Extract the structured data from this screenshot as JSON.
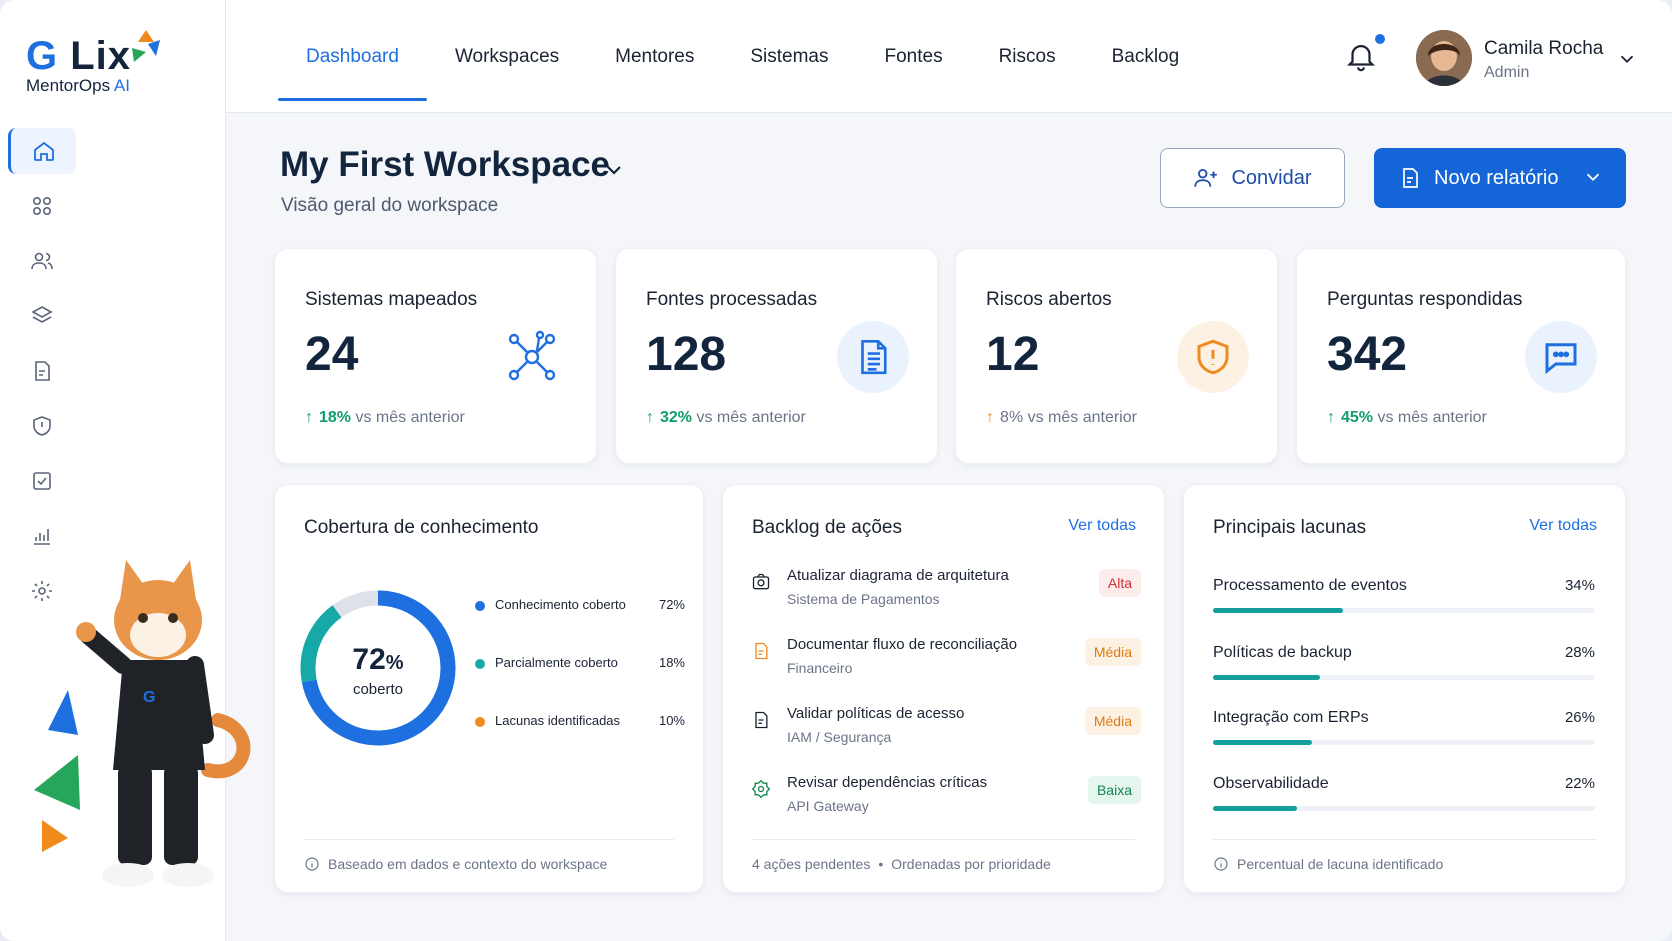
{
  "brand": {
    "logo_text": "GLix",
    "product": "MentorOps",
    "product_suffix": "AI"
  },
  "sidebar": {
    "items": [
      {
        "icon": "home-icon",
        "active": true
      },
      {
        "icon": "grid-icon"
      },
      {
        "icon": "users-icon"
      },
      {
        "icon": "layers-icon"
      },
      {
        "icon": "document-icon"
      },
      {
        "icon": "shield-icon"
      },
      {
        "icon": "checkbox-icon"
      },
      {
        "icon": "chart-icon"
      },
      {
        "icon": "gear-icon"
      }
    ]
  },
  "topnav": {
    "tabs": [
      "Dashboard",
      "Workspaces",
      "Mentores",
      "Sistemas",
      "Fontes",
      "Riscos",
      "Backlog"
    ],
    "active_tab": "Dashboard"
  },
  "user": {
    "name": "Camila Rocha",
    "role": "Admin"
  },
  "workspace": {
    "title": "My First Workspace",
    "subtitle": "Visão geral do workspace"
  },
  "actions": {
    "invite_label": "Convidar",
    "new_report_label": "Novo relatório"
  },
  "kpis": [
    {
      "label": "Sistemas mapeados",
      "value": "24",
      "delta": "18%",
      "delta_suffix": "vs mês anterior",
      "icon": "network-icon",
      "accent": "#1e6fe0"
    },
    {
      "label": "Fontes processadas",
      "value": "128",
      "delta": "32%",
      "delta_suffix": "vs mês anterior",
      "icon": "file-text-icon",
      "accent": "#1e6fe0"
    },
    {
      "label": "Riscos abertos",
      "value": "12",
      "delta": "8%",
      "delta_suffix": "vs mês anterior",
      "icon": "shield-alert-icon",
      "accent": "#f08a1c"
    },
    {
      "label": "Perguntas respondidas",
      "value": "342",
      "delta": "45%",
      "delta_suffix": "vs mês anterior",
      "icon": "chat-bubble-icon",
      "accent": "#1e6fe0"
    }
  ],
  "coverage": {
    "title": "Cobertura de conhecimento",
    "center_value": "72",
    "center_unit": "%",
    "center_label": "coberto",
    "legend": [
      {
        "name": "Conhecimento coberto",
        "value": "72%",
        "color": "#1e6fe0"
      },
      {
        "name": "Parcialmente coberto",
        "value": "18%",
        "color": "#17a8a8"
      },
      {
        "name": "Lacunas identificadas",
        "value": "10%",
        "color": "#f08a1c"
      }
    ],
    "footer": "Baseado em dados e contexto do workspace"
  },
  "chart_data": {
    "type": "pie",
    "title": "Cobertura de conhecimento",
    "categories": [
      "Conhecimento coberto",
      "Parcialmente coberto",
      "Lacunas identificadas"
    ],
    "values": [
      72,
      18,
      10
    ]
  },
  "backlog": {
    "title": "Backlog de ações",
    "link": "Ver todas",
    "items": [
      {
        "title": "Atualizar diagrama de arquitetura",
        "subtitle": "Sistema de Pagamentos",
        "priority": "Alta",
        "level": "alta",
        "icon": "camera-icon"
      },
      {
        "title": "Documentar fluxo de reconciliação",
        "subtitle": "Financeiro",
        "priority": "Média",
        "level": "media",
        "icon": "document-icon"
      },
      {
        "title": "Validar políticas de acesso",
        "subtitle": "IAM / Segurança",
        "priority": "Média",
        "level": "media",
        "icon": "document-icon"
      },
      {
        "title": "Revisar dependências críticas",
        "subtitle": "API Gateway",
        "priority": "Baixa",
        "level": "baixa",
        "icon": "badge-icon"
      }
    ],
    "footer_count": "4 ações pendentes",
    "footer_sort": "Ordenadas por prioridade"
  },
  "gaps": {
    "title": "Principais lacunas",
    "link": "Ver todas",
    "items": [
      {
        "name": "Processamento de eventos",
        "value": "34%",
        "fraction": 0.34
      },
      {
        "name": "Políticas de backup",
        "value": "28%",
        "fraction": 0.28
      },
      {
        "name": "Integração com ERPs",
        "value": "26%",
        "fraction": 0.26
      },
      {
        "name": "Observabilidade",
        "value": "22%",
        "fraction": 0.22
      }
    ],
    "footer": "Percentual de lacuna identificado"
  }
}
